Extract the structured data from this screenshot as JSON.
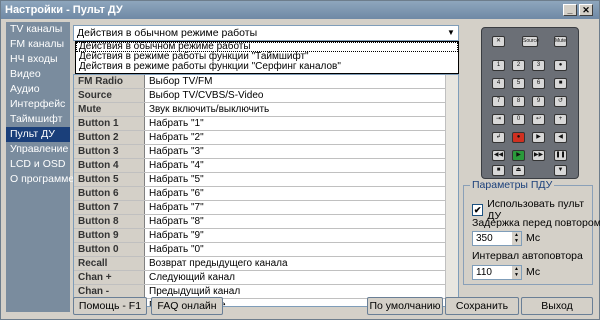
{
  "window": {
    "title": "Настройки - Пульт ДУ"
  },
  "sidebar": {
    "items": [
      {
        "label": "TV каналы"
      },
      {
        "label": "FM каналы"
      },
      {
        "label": "НЧ входы"
      },
      {
        "label": "Видео"
      },
      {
        "label": "Аудио"
      },
      {
        "label": "Интерфейс"
      },
      {
        "label": "Таймшифт"
      },
      {
        "label": "Пульт ДУ"
      },
      {
        "label": "Управление"
      },
      {
        "label": "LCD и OSD"
      },
      {
        "label": "О программе"
      }
    ],
    "active_index": 7
  },
  "mode_select": {
    "value": "Действия в обычном режиме работы",
    "options": [
      "Действия в обычном режиме работы",
      "Действия в режиме работы функции \"Таймшифт\"",
      "Действия в режиме работы функции \"Серфинг каналов\""
    ]
  },
  "bindings": [
    {
      "key": "FM Radio",
      "action": "Выбор TV/FM"
    },
    {
      "key": "Source",
      "action": "Выбор TV/CVBS/S-Video"
    },
    {
      "key": "Mute",
      "action": "Звук включить/выключить"
    },
    {
      "key": "Button 1",
      "action": "Набрать \"1\""
    },
    {
      "key": "Button 2",
      "action": "Набрать \"2\""
    },
    {
      "key": "Button 3",
      "action": "Набрать \"3\""
    },
    {
      "key": "Button 4",
      "action": "Набрать \"4\""
    },
    {
      "key": "Button 5",
      "action": "Набрать \"5\""
    },
    {
      "key": "Button 6",
      "action": "Набрать \"6\""
    },
    {
      "key": "Button 7",
      "action": "Набрать \"7\""
    },
    {
      "key": "Button 8",
      "action": "Набрать \"8\""
    },
    {
      "key": "Button 9",
      "action": "Набрать \"9\""
    },
    {
      "key": "Button 0",
      "action": "Набрать \"0\""
    },
    {
      "key": "Recall",
      "action": "Возврат предыдущего канала"
    },
    {
      "key": "Chan +",
      "action": "Следующий канал"
    },
    {
      "key": "Chan -",
      "action": "Предыдущий канал"
    },
    {
      "key": "Vol +",
      "action": "Громкость выше"
    }
  ],
  "remote": {
    "top_labels": [
      "Source",
      "Mute"
    ]
  },
  "params": {
    "title": "Параметры ПДУ",
    "use_remote_label": "Использовать пульт ДУ",
    "use_remote_checked": true,
    "repeat_delay_label": "Задержка перед повтором",
    "repeat_delay_value": "350",
    "repeat_delay_unit": "Мс",
    "autorepeat_label": "Интервал автоповтора",
    "autorepeat_value": "110",
    "autorepeat_unit": "Мс"
  },
  "buttons": {
    "help": "Помощь - F1",
    "faq": "FAQ онлайн",
    "defaults": "По умолчанию",
    "save": "Сохранить",
    "exit": "Выход"
  },
  "colors": {
    "accent": "#1a3f7a",
    "sidebar_bg": "#7a8c9e"
  }
}
